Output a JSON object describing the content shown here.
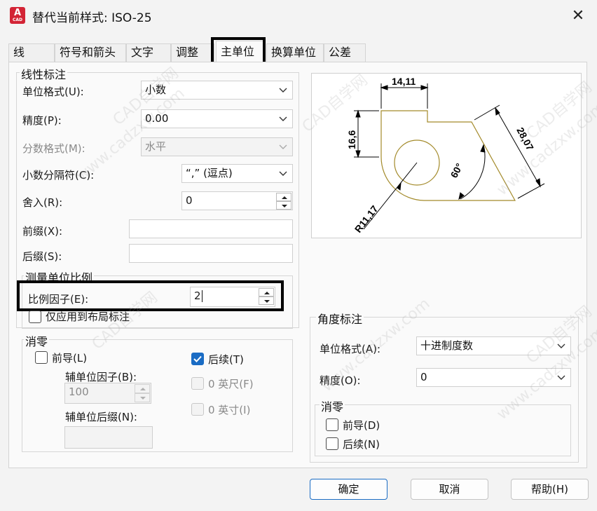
{
  "window": {
    "app_icon_text": "A",
    "app_icon_sub": "CAD",
    "title": "替代当前样式: ISO-25",
    "close_glyph": "✕"
  },
  "tabs": [
    {
      "label": "线"
    },
    {
      "label": "符号和箭头"
    },
    {
      "label": "文字"
    },
    {
      "label": "调整"
    },
    {
      "label": "主单位",
      "active": true
    },
    {
      "label": "换算单位"
    },
    {
      "label": "公差"
    }
  ],
  "linear": {
    "title": "线性标注",
    "unit_format": {
      "label": "单位格式(U):",
      "value": "小数"
    },
    "precision": {
      "label": "精度(P):",
      "value": "0.00"
    },
    "fraction_format": {
      "label": "分数格式(M):",
      "value": "水平"
    },
    "decimal_separator": {
      "label": "小数分隔符(C):",
      "value": "“,” (逗点)"
    },
    "round_off": {
      "label": "舍入(R):",
      "value": "0"
    },
    "prefix": {
      "label": "前缀(X):",
      "value": ""
    },
    "suffix": {
      "label": "后缀(S):",
      "value": ""
    }
  },
  "scale": {
    "title": "测量单位比例",
    "factor": {
      "label": "比例因子(E):",
      "value": "2"
    },
    "layout_only": {
      "label": "仅应用到布局标注",
      "checked": false
    }
  },
  "zero_linear": {
    "title": "消零",
    "leading": {
      "label": "前导(L)",
      "checked": false
    },
    "trailing": {
      "label": "后续(T)",
      "checked": true
    },
    "sub_unit_factor": {
      "label": "辅单位因子(B):",
      "value": "100"
    },
    "sub_unit_suffix": {
      "label": "辅单位后缀(N):",
      "value": ""
    },
    "feet": {
      "label": "0 英尺(F)",
      "checked": false
    },
    "inches": {
      "label": "0 英寸(I)",
      "checked": false
    }
  },
  "preview": {
    "dim_width": "14,11",
    "dim_height": "16,6",
    "dim_diag": "28,07",
    "dim_angle": "60°",
    "dim_radius": "R11,17",
    "line_color": "#a38a2a"
  },
  "angular": {
    "title": "角度标注",
    "unit_format": {
      "label": "单位格式(A):",
      "value": "十进制度数"
    },
    "precision": {
      "label": "精度(O):",
      "value": "0"
    },
    "zero_title": "消零",
    "leading": {
      "label": "前导(D)",
      "checked": false
    },
    "trailing": {
      "label": "后续(N)",
      "checked": false
    }
  },
  "buttons": {
    "ok": "确定",
    "cancel": "取消",
    "help": "帮助(H)"
  },
  "colors": {
    "accent": "#1a6cc4",
    "highlight": "#000000"
  },
  "watermarks": [
    "CAD自学网",
    "www.cadzxw.com"
  ]
}
